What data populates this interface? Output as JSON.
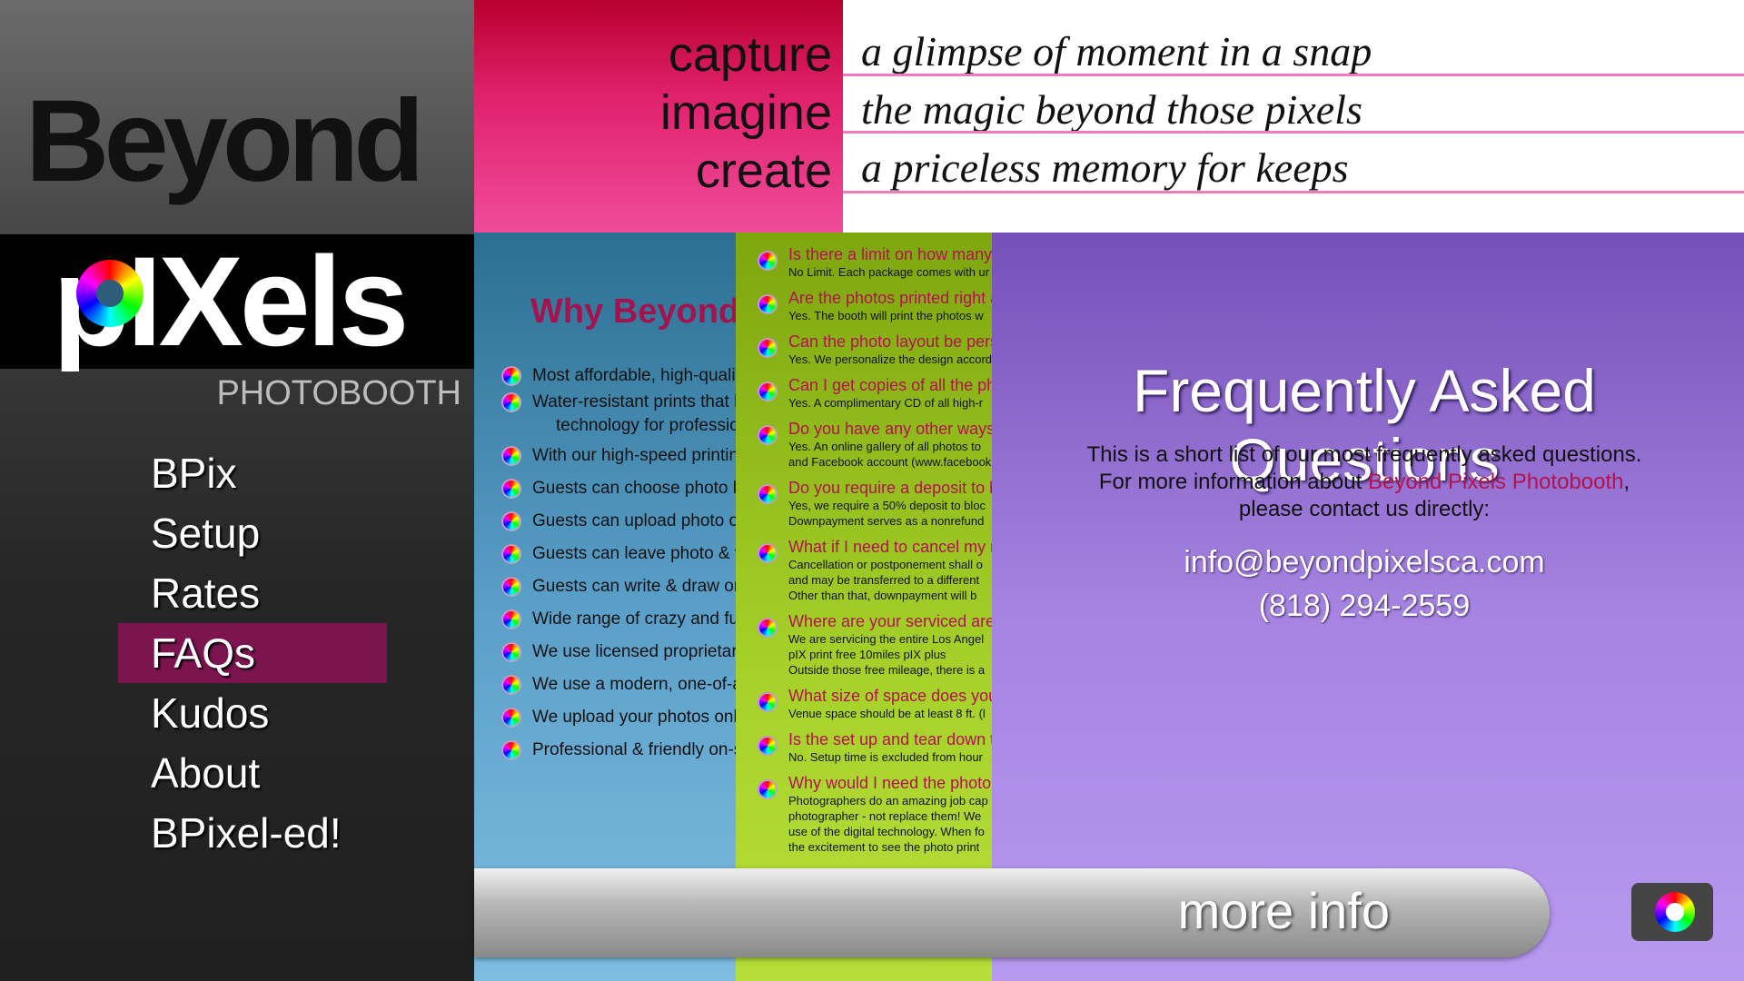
{
  "logo": {
    "beyond": "Beyond",
    "pixels": "pIXels",
    "photobooth": "PHOTOBOOTH"
  },
  "nav": [
    {
      "label": "BPix"
    },
    {
      "label": "Setup"
    },
    {
      "label": "Rates"
    },
    {
      "label": "FAQs",
      "active": true
    },
    {
      "label": "Kudos"
    },
    {
      "label": "About"
    },
    {
      "label": "BPixel-ed!"
    }
  ],
  "header": {
    "words": [
      "capture",
      "imagine",
      "create"
    ],
    "taglines": [
      "a glimpse of moment in a snap",
      "the magic beyond those pixels",
      "a priceless memory for keeps"
    ]
  },
  "why": {
    "title": "Why Beyond Pix",
    "items": [
      "Most affordable, high-quality",
      "Water-resistant prints that l",
      "technology for profession",
      "With our high-speed printing",
      "Guests can choose photo lay",
      "Guests can upload photo or",
      "Guests can leave photo & vi",
      "Guests can write & draw on",
      "Wide range of crazy and fun",
      "We use licensed proprietary",
      "We use a modern, one-of-a-k",
      "We upload your photos onlin",
      "Professional & friendly on-s"
    ]
  },
  "faq_list": [
    {
      "q": "Is there a limit on how many",
      "a": [
        "No Limit. Each package comes with ur"
      ]
    },
    {
      "q": "Are the photos printed right a",
      "a": [
        "Yes. The booth will print the photos w"
      ]
    },
    {
      "q": "Can the photo layout be perso",
      "a": [
        "Yes. We personalize the design accord"
      ]
    },
    {
      "q": "Can I get copies of all the pho",
      "a": [
        "Yes. A complimentary CD of all high-r"
      ]
    },
    {
      "q": "Do you have any other ways t",
      "a": [
        "Yes. An online gallery of all photos to",
        "and Facebook account (www.facebook"
      ]
    },
    {
      "q": "Do you require a deposit to bo",
      "a": [
        "Yes, we require a 50% deposit to bloc",
        "Downpayment serves as a nonrefund"
      ]
    },
    {
      "q": "What if I need to cancel my re",
      "a": [
        "Cancellation or postponement shall o",
        "and may be transferred to a different",
        "Other than that, downpayment will b"
      ]
    },
    {
      "q": "Where are your serviced area",
      "a": [
        "We are servicing the entire Los Angel",
        "pIX print free 10miles   pIX plus",
        "Outside those free mileage, there is a"
      ]
    },
    {
      "q": "What size of space does your",
      "a": [
        "Venue space should be at least 8 ft. (l"
      ]
    },
    {
      "q": "Is the set up and tear down ti",
      "a": [
        "No.  Setup time is excluded from hour"
      ]
    },
    {
      "q": "Why would I need the photo b",
      "a": [
        "Photographers do an amazing job cap",
        "photographer - not replace them! We",
        "use of the digital technology. When fo",
        "the excitement to see the photo print"
      ]
    }
  ],
  "faq_panel": {
    "title": "Frequently Asked Questions",
    "desc_line1": "This is a short list of our most frequently asked questions.",
    "desc_line2_prefix": "For more information about ",
    "desc_line2_highlight": "Beyond Pixels Photobooth",
    "desc_line2_suffix": ",",
    "desc_line3": "please contact us directly:",
    "email": "info@beyondpixelsca.com",
    "phone": "(818) 294-2559"
  },
  "footer": {
    "more_info": "more info"
  },
  "colors": {
    "accent": "#7c1450",
    "highlight": "#b2134e"
  },
  "icons": {
    "bullet": "color-wheel-icon",
    "camera": "camera-icon"
  }
}
